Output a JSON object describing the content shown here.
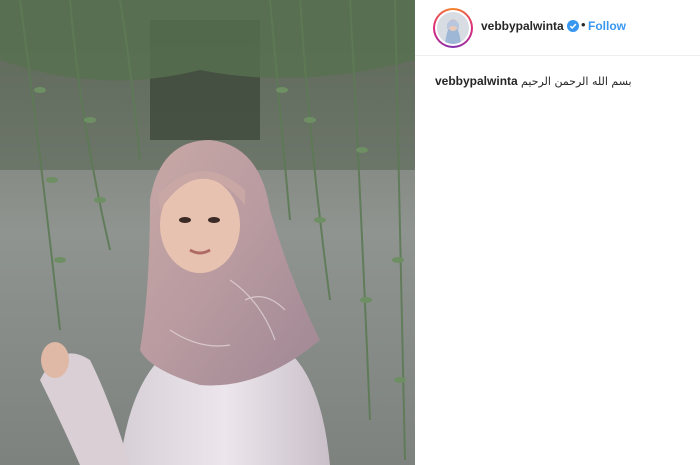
{
  "post": {
    "photo_icon": "hijab-portrait-photo",
    "author": {
      "username": "vebbypalwinta",
      "verified_icon": "verified-badge-icon",
      "separator": "•",
      "follow_label": "Follow"
    },
    "caption": {
      "username": "vebbypalwinta",
      "text": "بسم الله الرحمن الرحيم"
    }
  },
  "colors": {
    "link_blue": "#3897f0",
    "text_dark": "#262626",
    "divider": "#efefef"
  }
}
